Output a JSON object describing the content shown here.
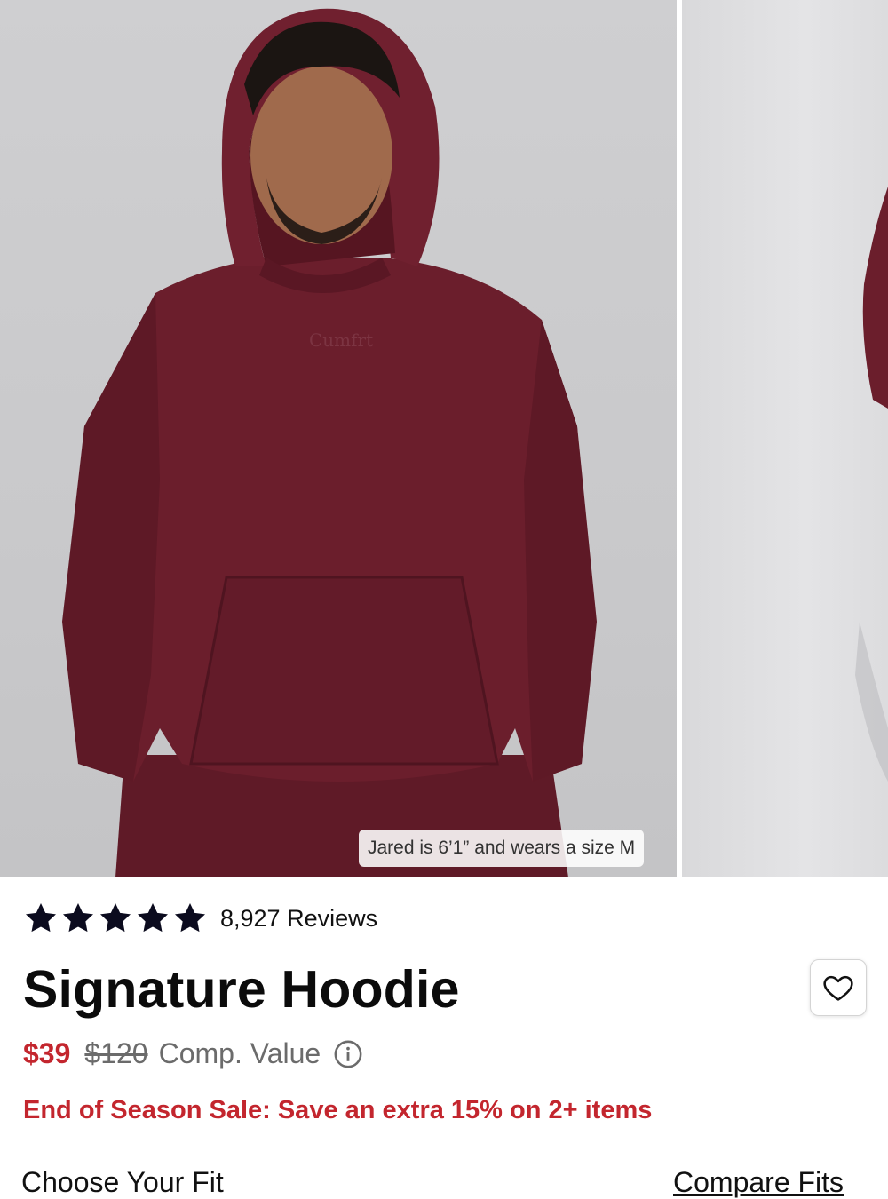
{
  "gallery": {
    "caption": "Jared is 6’1” and wears a size M",
    "hoodie_color": "#6b1e2c",
    "background_color": "#cbcbcd"
  },
  "product": {
    "rating_stars": 5,
    "reviews_label": "8,927 Reviews",
    "title": "Signature Hoodie",
    "price": "$39",
    "compare_price": "$120",
    "compare_label": "Comp. Value",
    "promo": "End of Season Sale: Save an extra 15% on 2+ items"
  },
  "sections": {
    "fit_label": "Choose Your Fit",
    "compare_link": "Compare Fits"
  },
  "colors": {
    "sale_red": "#c3262e",
    "text": "#111111",
    "muted": "#6b6b6b"
  },
  "icons": {
    "star": "star-icon",
    "wishlist": "heart-icon",
    "info": "info-icon"
  }
}
